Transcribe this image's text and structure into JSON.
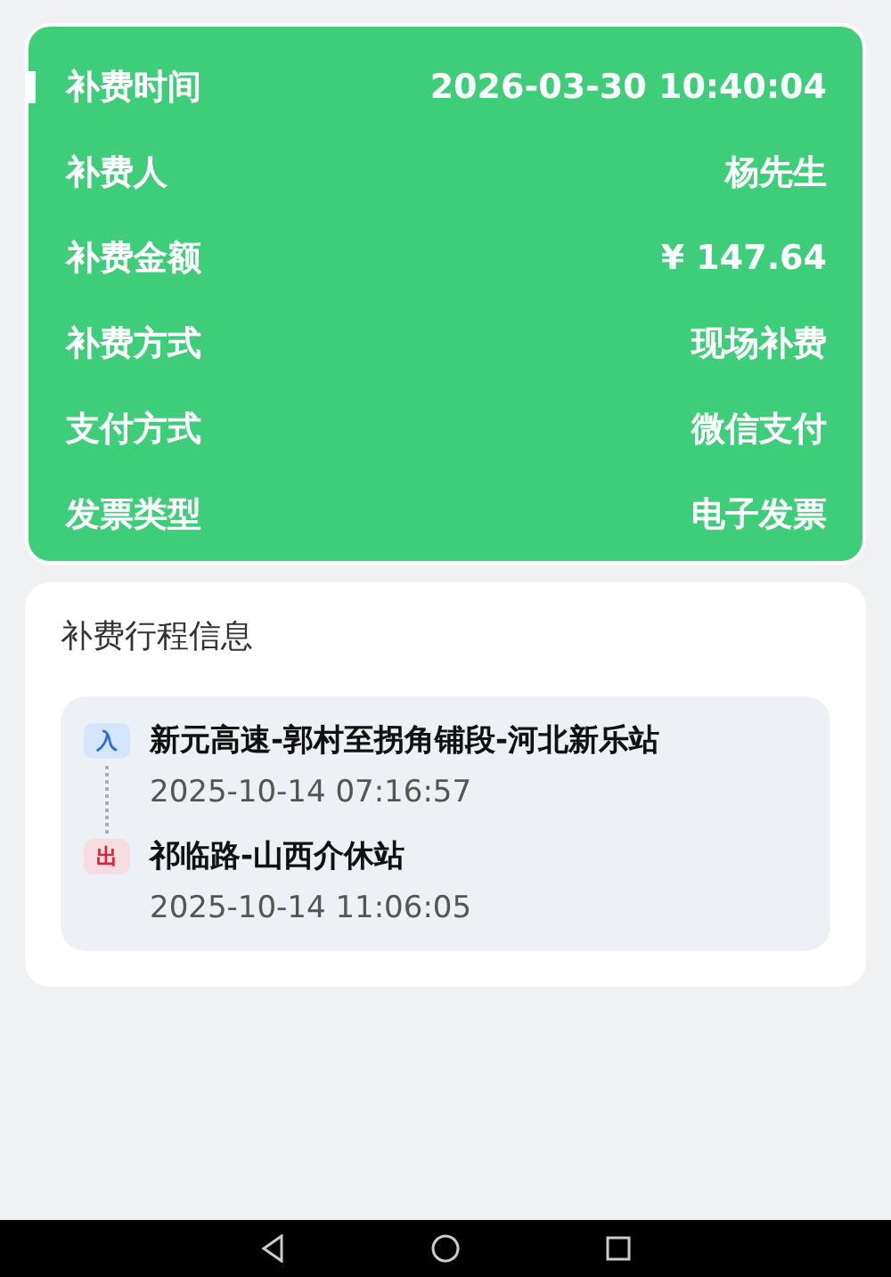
{
  "summary": {
    "rows": [
      {
        "label": "补费时间",
        "value": "2026-03-30 10:40:04"
      },
      {
        "label": "补费人",
        "value": "杨先生"
      },
      {
        "label": "补费金额",
        "value": "¥ 147.64"
      },
      {
        "label": "补费方式",
        "value": "现场补费"
      },
      {
        "label": "支付方式",
        "value": "微信支付"
      },
      {
        "label": "发票类型",
        "value": "电子发票"
      }
    ]
  },
  "trip": {
    "title": "补费行程信息",
    "stops": [
      {
        "kind": "entry",
        "badge": "入",
        "station": "新元高速-郭村至拐角铺段-河北新乐站",
        "time": "2025-10-14 07:16:57"
      },
      {
        "kind": "exit",
        "badge": "出",
        "station": "祁临路-山西介休站",
        "time": "2025-10-14 11:06:05"
      }
    ]
  }
}
